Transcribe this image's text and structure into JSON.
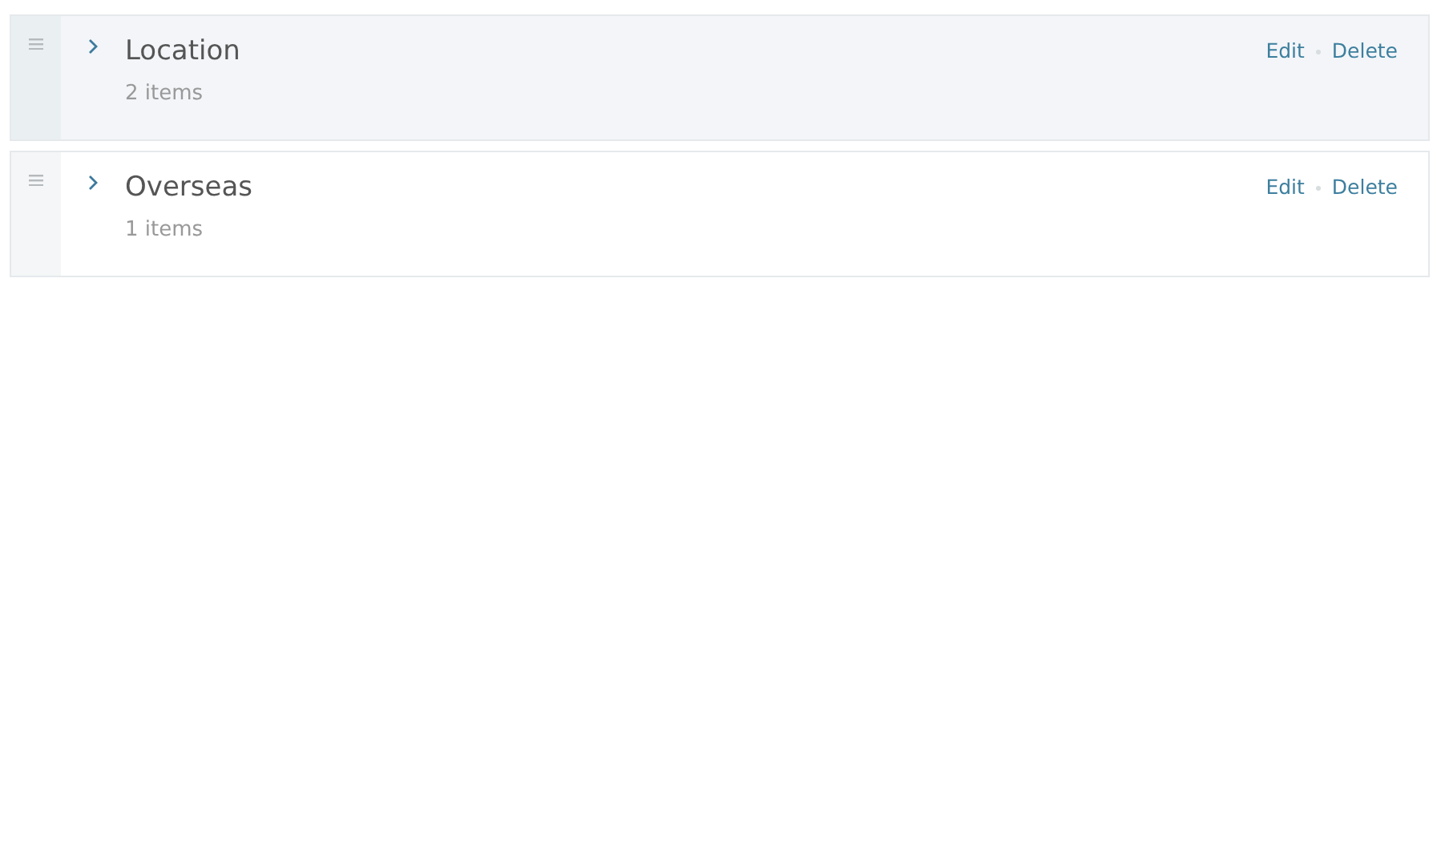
{
  "groups": [
    {
      "title": "Location",
      "count": "2 items",
      "highlighted": true,
      "expanded": false,
      "actions": [
        "Edit",
        "Delete"
      ]
    },
    {
      "title": "Overseas",
      "count": "1 items",
      "highlighted": false,
      "expanded": false,
      "actions": [
        "Edit",
        "Delete"
      ]
    }
  ]
}
